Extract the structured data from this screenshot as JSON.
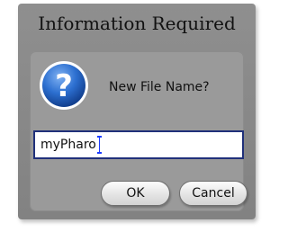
{
  "dialog": {
    "title": "Information Required",
    "prompt": "New File Name?",
    "icon": "question-icon",
    "input": {
      "value": "myPharo"
    },
    "buttons": {
      "ok_label": "OK",
      "cancel_label": "Cancel"
    }
  },
  "colors": {
    "dialog_bg": "#8f8f8f",
    "icon_blue": "#1d5fc0",
    "input_border": "#20307a",
    "caret": "#1b3cff"
  }
}
